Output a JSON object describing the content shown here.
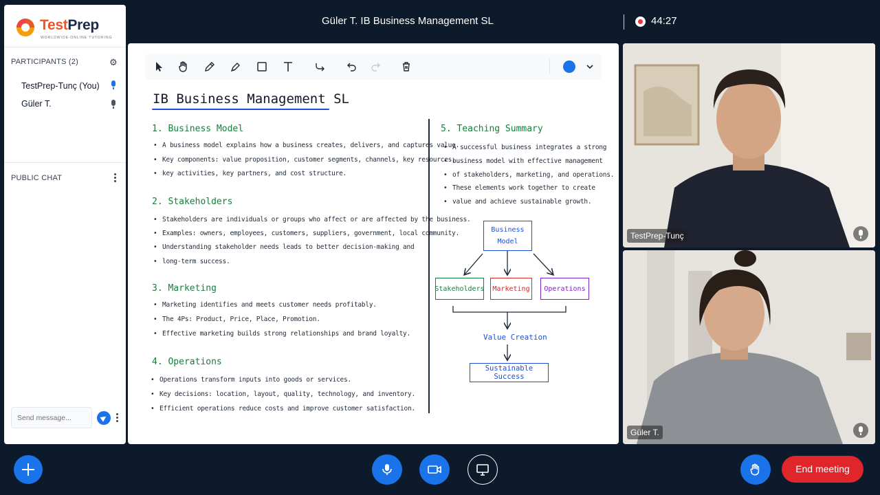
{
  "topbar": {
    "meeting_title": "Güler T. IB Business Management SL",
    "recording_icon": "record-icon",
    "timer": "44:27",
    "signal_icon": "signal-bars-icon",
    "menu_icon": "more-vert-icon"
  },
  "sidebar": {
    "logo": {
      "name": "TestPrep",
      "tagline": "WORLDWIDE ONLINE TUTORING",
      "icon": "testprep-logo-icon"
    },
    "participants_header": "PARTICIPANTS (2)",
    "participants": [
      {
        "name": "TestPrep-Tunç (You)",
        "mic_color": "#1a73e8",
        "icon": "mic-icon"
      },
      {
        "name": "Güler T.",
        "mic_color": "#4b5563",
        "icon": "mic-icon"
      }
    ],
    "chat_header": "PUBLIC CHAT",
    "chat_placeholder": "Send message..."
  },
  "whiteboard": {
    "tools": [
      "select-icon",
      "hand-icon",
      "pencil-icon",
      "marker-icon",
      "rectangle-icon",
      "text-icon",
      "connector-icon",
      "undo-icon",
      "redo-icon",
      "delete-icon"
    ],
    "selected_color": "#1a73e8",
    "title": "IB Business Management SL",
    "left_sections": [
      {
        "heading": "1. Business Model",
        "bullets": [
          "A business model explains how a business creates, delivers, and captures value.",
          "Key components: value proposition, customer segments, channels, key resources,",
          "key activities, key partners, and cost structure."
        ]
      },
      {
        "heading": "2. Stakeholders",
        "bullets": [
          "Stakeholders are individuals or groups who affect or are affected by the business.",
          "Examples: owners, employees, customers, suppliers, government, local community.",
          "Understanding stakeholder needs leads to better decision-making and",
          "long-term success."
        ]
      },
      {
        "heading": "3. Marketing",
        "bullets": [
          "Marketing identifies and meets customer needs profitably.",
          "The 4Ps: Product, Price, Place, Promotion.",
          "Effective marketing builds strong relationships and brand loyalty."
        ]
      },
      {
        "heading": "4. Operations",
        "bullets": [
          "Operations transform inputs into goods or services.",
          "Key decisions: location, layout, quality, technology, and inventory.",
          "Efficient operations reduce costs and improve customer satisfaction."
        ]
      }
    ],
    "summary": {
      "heading": "5. Teaching Summary",
      "lines": [
        "A successful business integrates a strong",
        "business model with effective management",
        "of stakeholders, marketing, and operations.",
        "These elements work together to create",
        "value and achieve sustainable growth."
      ]
    },
    "diagram": {
      "top": "Business Model",
      "top_line1": "Business",
      "top_line2": "Model",
      "middle": [
        "Stakeholders",
        "Marketing",
        "Operations"
      ],
      "middle_colors": [
        "#15803d",
        "#dc2626",
        "#7e22ce"
      ],
      "result": "Value Creation",
      "final": "Sustainable Success"
    }
  },
  "videos": [
    {
      "name": "TestPrep-Tunç",
      "mic_icon": "mic-icon"
    },
    {
      "name": "Güler T.",
      "mic_icon": "mic-icon"
    }
  ],
  "controls": {
    "add_icon": "plus-icon",
    "mic_icon": "mic-icon",
    "camera_icon": "camera-icon",
    "screen_icon": "screen-share-icon",
    "raise_hand_icon": "raise-hand-icon",
    "end_label": "End meeting"
  }
}
